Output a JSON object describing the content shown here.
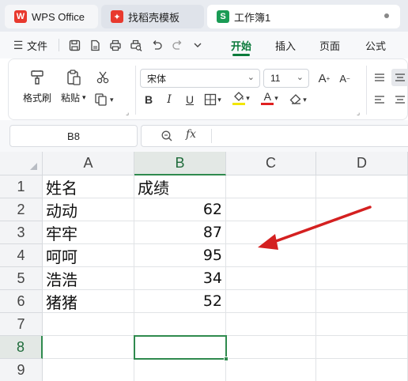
{
  "tabs": [
    {
      "label": "WPS Office",
      "icon": "wps-logo-icon",
      "color": "#e8392e"
    },
    {
      "label": "找稻壳模板",
      "icon": "daoke-logo-icon",
      "color": "#e8392e"
    },
    {
      "label": "工作簿1",
      "icon": "sheet-icon",
      "icon_letter": "S",
      "color": "#1a9b55"
    }
  ],
  "menu": {
    "file_label": "文件",
    "ribbon_tabs": [
      "开始",
      "插入",
      "页面",
      "公式"
    ],
    "active_tab": "开始"
  },
  "ribbon": {
    "format_painter": "格式刷",
    "paste": "粘贴",
    "font_name": "宋体",
    "font_size": "11",
    "font_color": "#e02020",
    "highlight_color": "#f2e600"
  },
  "formula_bar": {
    "name_box": "B8",
    "formula": ""
  },
  "sheet": {
    "columns": [
      "A",
      "B",
      "C",
      "D"
    ],
    "rows": [
      "1",
      "2",
      "3",
      "4",
      "5",
      "6",
      "7",
      "8",
      "9"
    ],
    "selected_column": "B",
    "selected_row": "8",
    "cells": [
      [
        "姓名",
        "成绩"
      ],
      [
        "动动",
        "62"
      ],
      [
        "牢牢",
        "87"
      ],
      [
        "呵呵",
        "95"
      ],
      [
        "浩浩",
        "34"
      ],
      [
        "猪猪",
        "52"
      ]
    ]
  },
  "annotation": {
    "arrow_color": "#d42020"
  }
}
